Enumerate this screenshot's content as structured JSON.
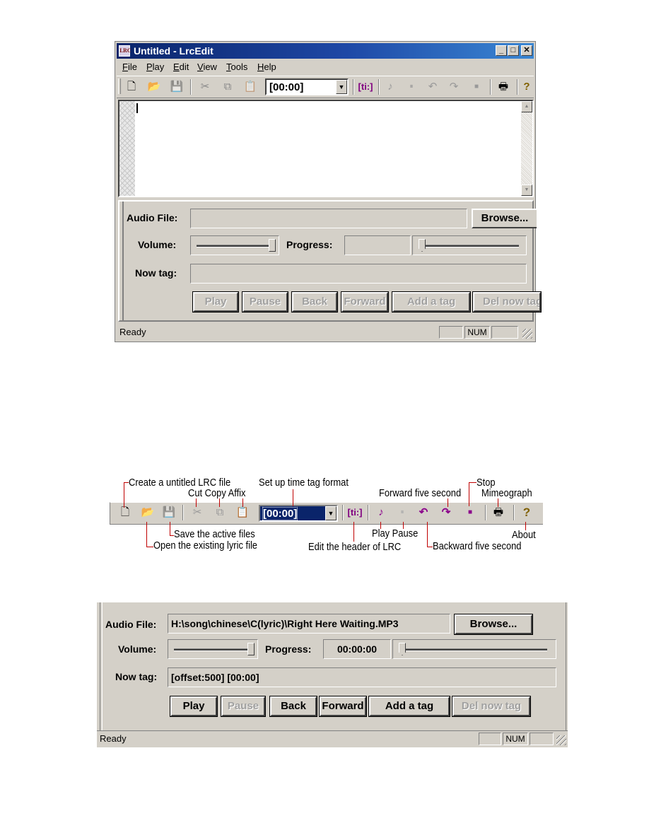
{
  "window1": {
    "title": "Untitled - LrcEdit",
    "app_icon_text": "LRC",
    "caption_buttons": {
      "minimize": "_",
      "maximize": "□",
      "close": "✕"
    },
    "menu": [
      {
        "label": "File",
        "accel": "F",
        "rest": "ile"
      },
      {
        "label": "Play",
        "accel": "P",
        "rest": "lay"
      },
      {
        "label": "Edit",
        "accel": "E",
        "rest": "dit"
      },
      {
        "label": "View",
        "accel": "V",
        "rest": "iew"
      },
      {
        "label": "Tools",
        "accel": "T",
        "rest": "ools"
      },
      {
        "label": "Help",
        "accel": "H",
        "rest": "elp"
      }
    ],
    "toolbar": {
      "new_icon": "🗋",
      "open_icon": "📂",
      "save_icon": "💾",
      "cut_icon": "✂",
      "copy_icon": "⧉",
      "paste_icon": "📋",
      "time_format_value": "[00:00]",
      "dropdown_arrow": "▼",
      "header_button": "[ti:]",
      "play_icon": "♪",
      "pause_icon": "⏸",
      "back5_icon": "↶",
      "fwd5_icon": "↷",
      "stop_icon": "■",
      "print_icon": "🖶",
      "about_icon": "?"
    },
    "editor": {
      "content": ""
    },
    "scroll_up": "▲",
    "scroll_down": "▼",
    "panel": {
      "audio_file_label": "Audio File:",
      "audio_file_value": "",
      "browse_label": "Browse...",
      "volume_label": "Volume:",
      "volume_level": 1.0,
      "progress_label": "Progress:",
      "progress_time": "",
      "progress_level": 0.0,
      "now_tag_label": "Now tag:",
      "now_tag_value": "",
      "buttons": [
        {
          "label": "Play",
          "enabled": false
        },
        {
          "label": "Pause",
          "enabled": false
        },
        {
          "label": "Back",
          "enabled": false
        },
        {
          "label": "Forward",
          "enabled": false
        },
        {
          "label": "Add a tag",
          "enabled": false
        },
        {
          "label": "Del now tag",
          "enabled": false
        }
      ]
    },
    "status": {
      "text": "Ready",
      "panes": [
        "",
        "NUM",
        ""
      ]
    }
  },
  "diagram": {
    "time_format_value": "[00:00]",
    "header_button": "[ti:]",
    "callouts": {
      "create": "Create a untitled LRC file",
      "cut_copy_affix": "Cut Copy Affix",
      "time_format": "Set up time tag format",
      "forward5": "Forward five second",
      "stop": "Stop",
      "mimeograph": "Mimeograph",
      "save": "Save the active files",
      "open": "Open the existing lyric file",
      "edit_header": "Edit the header of LRC",
      "play_pause": "Play Pause",
      "backward5": "Backward five second",
      "about": "About"
    },
    "accent_color": "#8b008b",
    "callout_line_color": "#c00000"
  },
  "window2": {
    "audio_file_label": "Audio File:",
    "audio_file_value": "H:\\song\\chinese\\C(lyric)\\Right Here Waiting.MP3",
    "browse_label": "Browse...",
    "volume_label": "Volume:",
    "volume_level": 1.0,
    "progress_label": "Progress:",
    "progress_time": "00:00:00",
    "progress_level": 0.0,
    "now_tag_label": "Now tag:",
    "now_tag_value": "[offset:500] [00:00]",
    "buttons": [
      {
        "label": "Play",
        "enabled": true
      },
      {
        "label": "Pause",
        "enabled": false
      },
      {
        "label": "Back",
        "enabled": true
      },
      {
        "label": "Forward",
        "enabled": true
      },
      {
        "label": "Add a tag",
        "enabled": true
      },
      {
        "label": "Del now tag",
        "enabled": false
      }
    ],
    "status": {
      "text": "Ready",
      "panes": [
        "",
        "NUM",
        ""
      ]
    }
  }
}
